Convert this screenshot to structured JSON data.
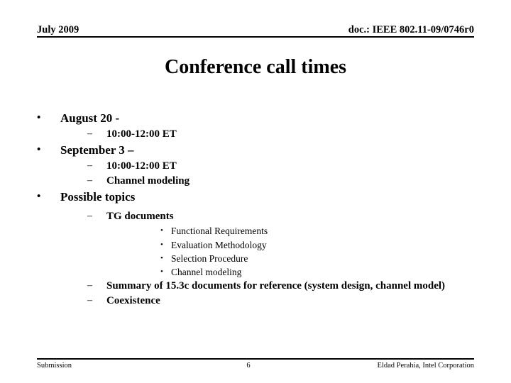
{
  "header": {
    "left": "July 2009",
    "right": "doc.: IEEE 802.11-09/0746r0"
  },
  "title": "Conference call times",
  "markers": {
    "level1": "•",
    "level2": "–",
    "level3": "•"
  },
  "content": {
    "items": [
      {
        "label": "August 20 -",
        "children": [
          {
            "label": "10:00-12:00 ET",
            "children": []
          }
        ]
      },
      {
        "label": "September 3 –",
        "children": [
          {
            "label": "10:00-12:00 ET",
            "children": []
          },
          {
            "label": "Channel modeling",
            "children": []
          }
        ]
      },
      {
        "label": "Possible topics",
        "children": [
          {
            "label": "TG documents",
            "children": [
              {
                "label": "Functional Requirements"
              },
              {
                "label": "Evaluation Methodology"
              },
              {
                "label": "Selection Procedure"
              },
              {
                "label": "Channel modeling"
              }
            ]
          },
          {
            "label": "Summary of 15.3c documents for reference (system design, channel model)",
            "children": []
          },
          {
            "label": "Coexistence",
            "children": []
          }
        ]
      }
    ]
  },
  "footer": {
    "left": "Submission",
    "page": "6",
    "right": "Eldad Perahia, Intel Corporation"
  }
}
